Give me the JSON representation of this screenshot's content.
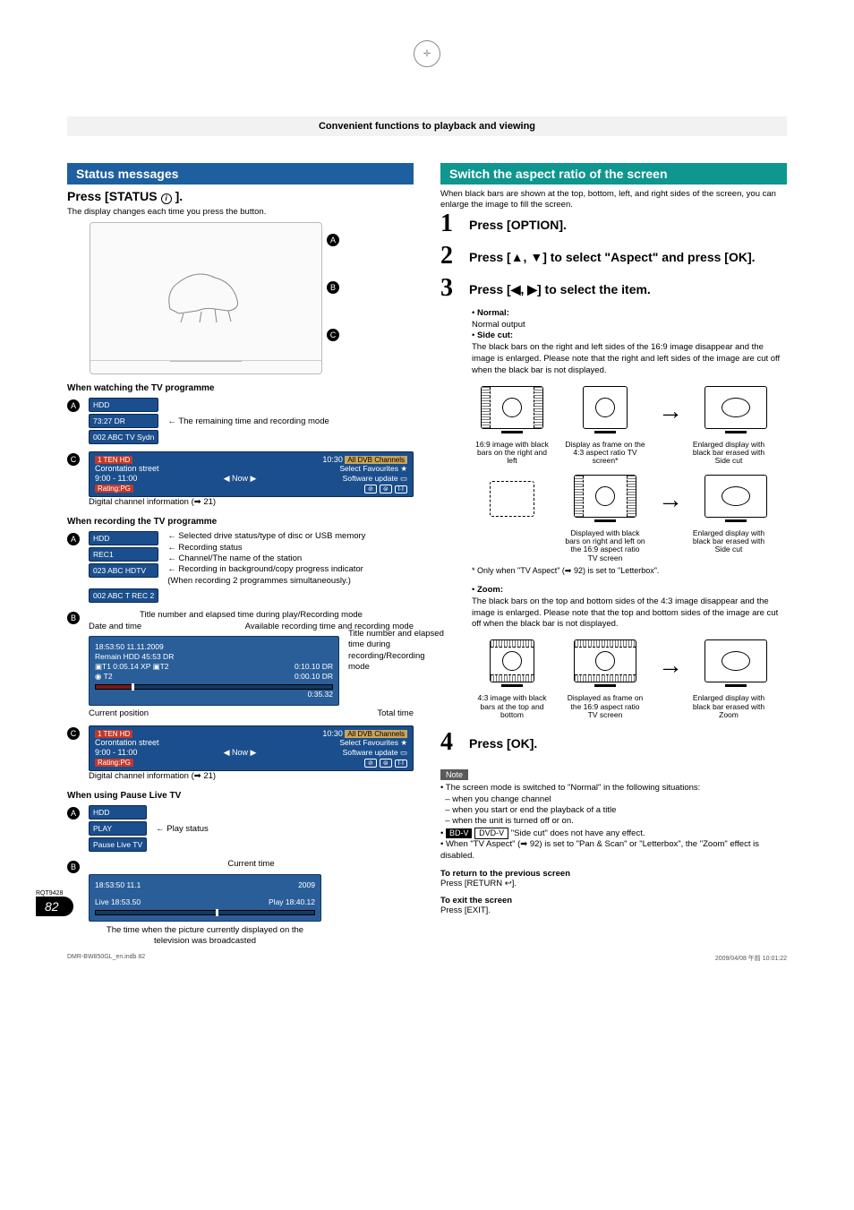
{
  "breadcrumb": "Convenient functions to playback and viewing",
  "left": {
    "section_title": "Status messages",
    "press_status": "Press [STATUS ",
    "press_status_icon": "i",
    "press_status_end": "].",
    "press_status_desc": "The display changes each time you press the button.",
    "tv_letters": {
      "a": "A",
      "b": "B",
      "c": "C"
    },
    "watching": {
      "heading": "When watching the TV programme",
      "a": {
        "line1": "HDD",
        "line2": "73:27 DR",
        "line3": "002 ABC TV Sydn",
        "right": "The remaining time and recording mode"
      },
      "c": {
        "row1_left": "1 TEN HD",
        "row1_time": "10:30",
        "row1_right": "All DVB Channels",
        "row2_left": "Corontation street",
        "row2_right": "Select Favourites",
        "row3_left": "9:00 - 11:00",
        "row3_mid": "◀ Now ▶",
        "row3_right": "Software update",
        "row4_left": "Rating:PG",
        "below": "Digital channel information (➡ 21)"
      }
    },
    "recording": {
      "heading": "When recording the TV programme",
      "a": {
        "line1": "HDD",
        "line2": "REC1",
        "line3": "023 ABC HDTV",
        "line4": "002 ABC T REC 2",
        "r_lines": [
          "Selected drive status/type of disc or USB memory",
          "Recording status",
          "Channel/The name of the station",
          "Recording in background/copy progress indicator (When recording 2 programmes simultaneously.)"
        ]
      },
      "b_top": "Title number and elapsed time during play/Recording mode",
      "b_dt": "Date and time",
      "b_avail": "Available recording time and recording mode",
      "b_panel": {
        "top": "18:53:50 11.11.2009",
        "remain": "Remain  HDD 45:53  DR",
        "t1": "▣T1    0:05.14   XP   ▣T2",
        "t1_r": "0:10.10   DR",
        "t2blank": "◉ T2",
        "t2_r": "0:00.10   DR",
        "total": "0:35.32"
      },
      "b_labels": {
        "title_elapsed": "Title number and elapsed time during recording/Recording mode",
        "current": "Current position",
        "total": "Total time"
      }
    },
    "pause": {
      "heading": "When using Pause Live TV",
      "a": {
        "line1": "HDD",
        "line2": "PLAY",
        "line3": "Pause Live TV",
        "r": "Play status"
      },
      "b_label": "Current time",
      "b_panel": {
        "top_l": "18:53:50 11.1",
        "top_r": "2009",
        "live": "Live  18:53.50",
        "play": "Play   18:40.12"
      },
      "caption": "The time when the picture currently displayed on the television was broadcasted"
    }
  },
  "right": {
    "section_title": "Switch the aspect ratio of the screen",
    "intro": "When black bars are shown at the top, bottom, left, and right sides of the screen, you can enlarge the image to fill the screen.",
    "step1": "Press [OPTION].",
    "step2": "Press [▲, ▼] to select \"Aspect\" and press [OK].",
    "step3": "Press [◀, ▶] to select the item.",
    "normal_t": "Normal:",
    "normal_b": "Normal output",
    "side_t": "Side cut:",
    "side_b": "The black bars on the right and left sides of the 16:9 image disappear and the image is enlarged. Please note that the right and left sides of the image are cut off when the black bar is not displayed.",
    "diag1": {
      "c1": "16:9 image with black bars on the right and left",
      "c2": "Display as frame on the 4:3 aspect ratio TV screen*",
      "c3": "Enlarged display with black bar erased with Side cut"
    },
    "diag2": {
      "c1": "",
      "c2": "Displayed with black bars on right and left on the 16:9 aspect ratio TV screen",
      "c3": "Enlarged display with black bar erased with Side cut"
    },
    "star": "* Only when \"TV Aspect\" (➡ 92) is set to \"Letterbox\".",
    "zoom_t": "Zoom:",
    "zoom_b": "The black bars on the top and bottom sides of the 4:3 image disappear and the image is enlarged. Please note that the top and bottom sides of the image are cut off when the black bar is not displayed.",
    "diag3": {
      "c1": "4:3 image with black bars at the top and bottom",
      "c2": "Displayed as frame on the 16:9 aspect ratio TV screen",
      "c3": "Enlarged display with black bar erased with Zoom"
    },
    "step4": "Press [OK].",
    "note": "Note",
    "notes": [
      "The screen mode is switched to \"Normal\" in the following situations:",
      "– when you change channel",
      "– when you start or end the playback of a title",
      "– when the unit is turned off or on."
    ],
    "bdv": "BD-V",
    "dvdv": "DVD-V",
    "bdv_note": " \"Side cut\" does not have any effect.",
    "tva_note": "When \"TV Aspect\" (➡ 92) is set to \"Pan & Scan\" or \"Letterbox\", the \"Zoom\" effect is disabled.",
    "return_t": "To return to the previous screen",
    "return_b": "Press [RETURN ↩].",
    "exit_t": "To exit the screen",
    "exit_b": "Press [EXIT]."
  },
  "footer": {
    "rqt": "RQT9428",
    "page": "82",
    "file_l": "DMR-BW850GL_en.indb   82",
    "file_r": "2009/04/08   午前 10:01:22"
  }
}
